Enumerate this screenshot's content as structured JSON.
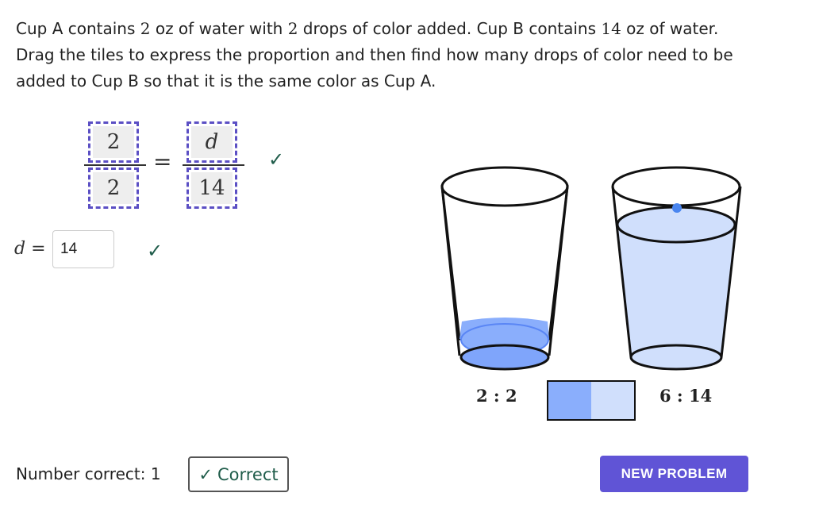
{
  "problem": {
    "line1_pre": "Cup A contains ",
    "line1_a_oz": "2",
    "line1_mid": " oz of water with ",
    "line1_a_drops": "2",
    "line1_mid2": " drops of color added. Cup B contains ",
    "line1_b_oz": "14",
    "line1_post": " oz of water.",
    "line2": "Drag the tiles to express the proportion and then find how many drops of color need to be",
    "line3": "added to Cup B so that it is the same color as Cup A."
  },
  "proportion": {
    "left_numerator": "2",
    "left_denominator": "2",
    "equals": "=",
    "right_numerator": "d",
    "right_denominator": "14",
    "check": "✓"
  },
  "answer": {
    "label": "d =",
    "value": "14",
    "check": "✓"
  },
  "cups": {
    "cup_a_ratio": "2 : 2",
    "cup_b_ratio": "6 : 14",
    "cup_a_fill_fraction": 0.12,
    "cup_b_fill_fraction": 0.85
  },
  "colors": {
    "accent": "#6054d6",
    "tile_border": "#5b4fc4",
    "check_green": "#1f5c4a",
    "cup_a_liquid": "#8aaefc",
    "cup_a_liquid_edge": "#5a86f5",
    "cup_b_liquid": "#d0dffc",
    "swatch_a": "#8aaefc",
    "swatch_b": "#d0dffc"
  },
  "footer": {
    "number_correct_label": "Number correct: 1",
    "status_icon": "✓",
    "status_text": "Correct",
    "new_problem_label": "NEW PROBLEM"
  }
}
